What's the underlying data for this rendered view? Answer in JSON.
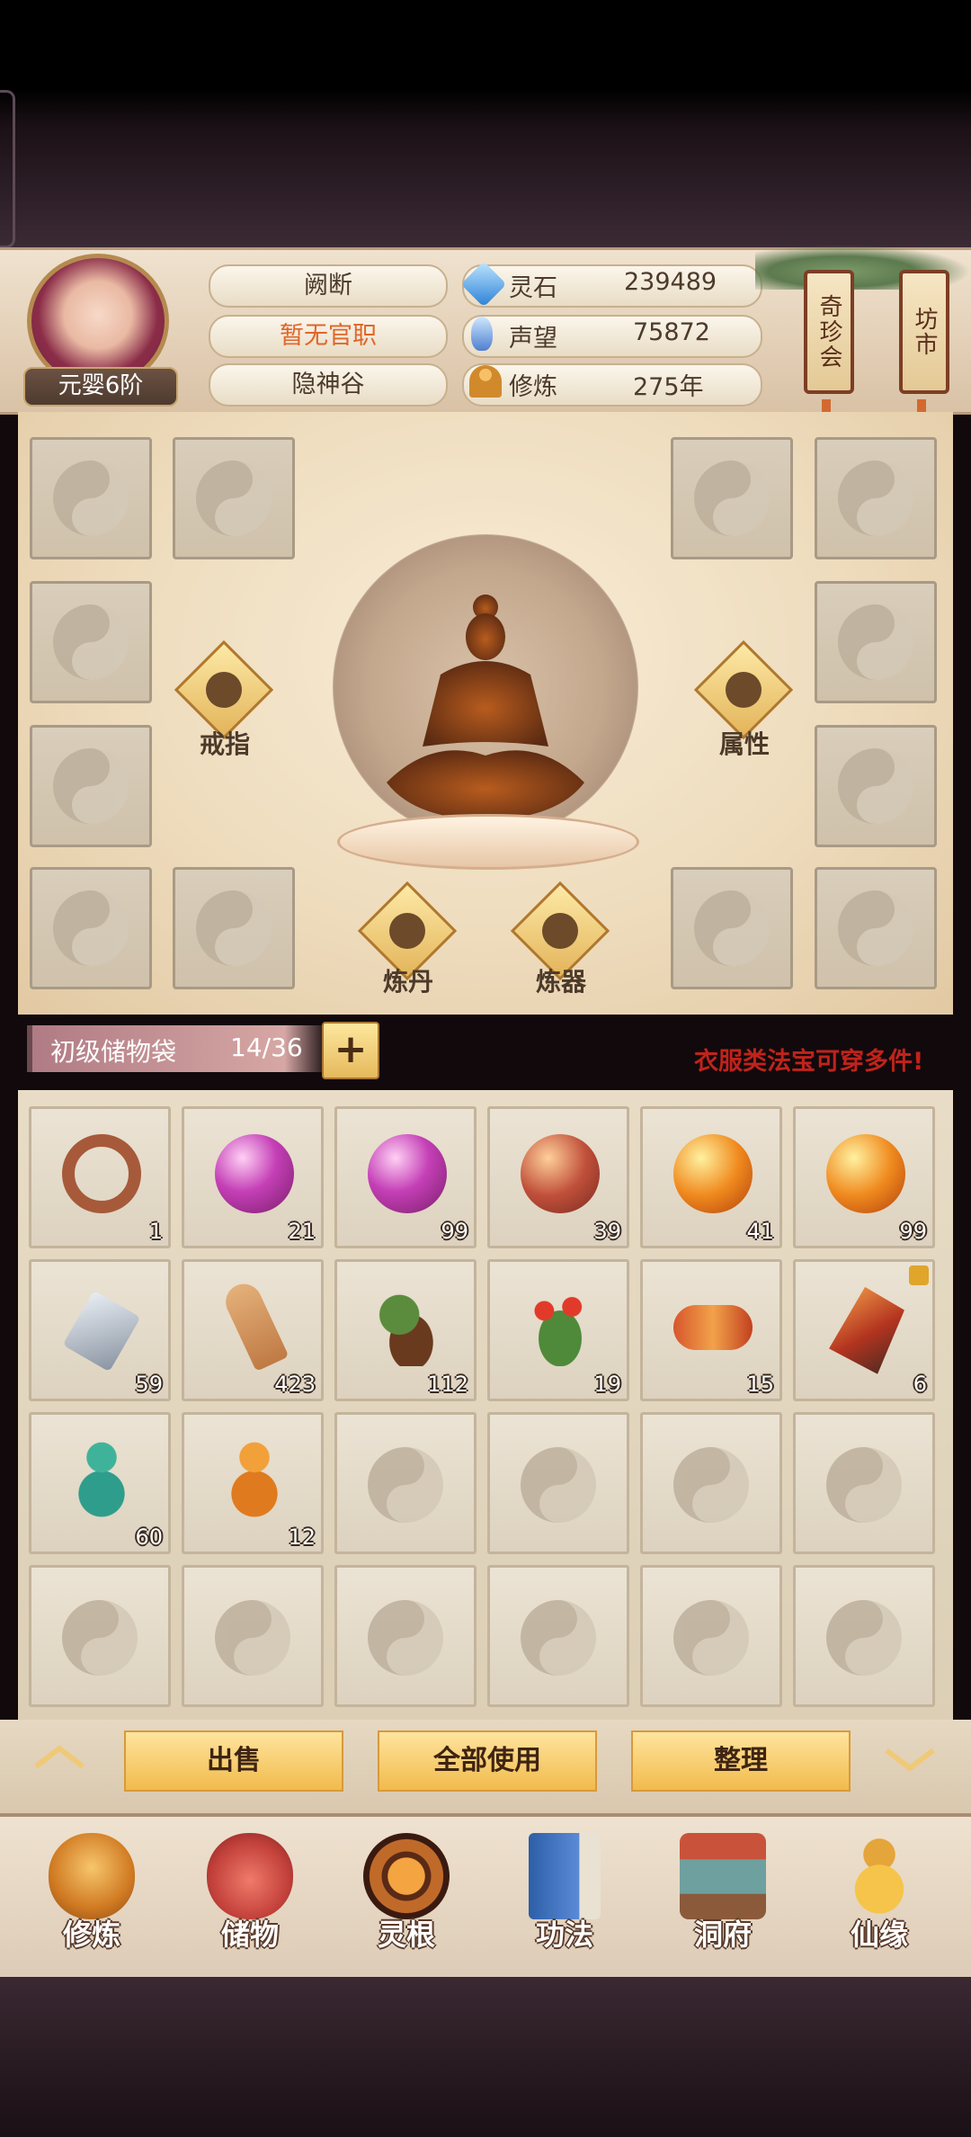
{
  "player": {
    "realm": "元婴6阶",
    "name": "阙断",
    "official_rank": "暂无官职",
    "sect": "隐神谷"
  },
  "resources": [
    {
      "icon": "spirit-stone-icon",
      "label": "灵石",
      "value": "239489"
    },
    {
      "icon": "reputation-crystal-icon",
      "label": "声望",
      "value": "75872"
    },
    {
      "icon": "cultivation-meditation-icon",
      "label": "修炼",
      "value": "275年"
    }
  ],
  "side_tags": {
    "treasure_auction": "奇珍会",
    "market": "坊市"
  },
  "equip": {
    "ring_label": "戒指",
    "attribute_label": "属性",
    "alchemy_label": "炼丹",
    "forge_label": "炼器"
  },
  "bag": {
    "title": "初级储物袋",
    "capacity": "14/36",
    "plus": "+",
    "notice": "衣服类法宝可穿多件!"
  },
  "inventory": [
    {
      "icon": "ring-item-icon",
      "qty": "1"
    },
    {
      "icon": "purple-orb-icon",
      "qty": "21"
    },
    {
      "icon": "purple-orb-icon",
      "qty": "99"
    },
    {
      "icon": "red-orb-icon",
      "qty": "39"
    },
    {
      "icon": "orange-fire-orb-icon",
      "qty": "41"
    },
    {
      "icon": "orange-fire-orb-icon",
      "qty": "99"
    },
    {
      "icon": "silver-ore-icon",
      "qty": "59"
    },
    {
      "icon": "ginseng-root-icon",
      "qty": "423"
    },
    {
      "icon": "herb-root-icon",
      "qty": "112"
    },
    {
      "icon": "red-flower-herb-icon",
      "qty": "19"
    },
    {
      "icon": "cordyceps-icon",
      "qty": "15"
    },
    {
      "icon": "red-crystal-icon",
      "qty": "6"
    },
    {
      "icon": "green-gourd-icon",
      "qty": "60"
    },
    {
      "icon": "orange-gourd-icon",
      "qty": "12"
    }
  ],
  "actions": {
    "sell": "出售",
    "use_all": "全部使用",
    "sort": "整理"
  },
  "nav": [
    {
      "icon": "cultivate-icon",
      "label": "修炼"
    },
    {
      "icon": "storage-bag-icon",
      "label": "储物"
    },
    {
      "icon": "spirit-root-icon",
      "label": "灵根"
    },
    {
      "icon": "technique-book-icon",
      "label": "功法"
    },
    {
      "icon": "cave-residence-icon",
      "label": "洞府"
    },
    {
      "icon": "fortune-gourd-icon",
      "label": "仙缘"
    }
  ],
  "colors": {
    "rank_text": "#e0662a",
    "notice_text": "#c0231b",
    "accent_gold": "#f1bb4c"
  }
}
